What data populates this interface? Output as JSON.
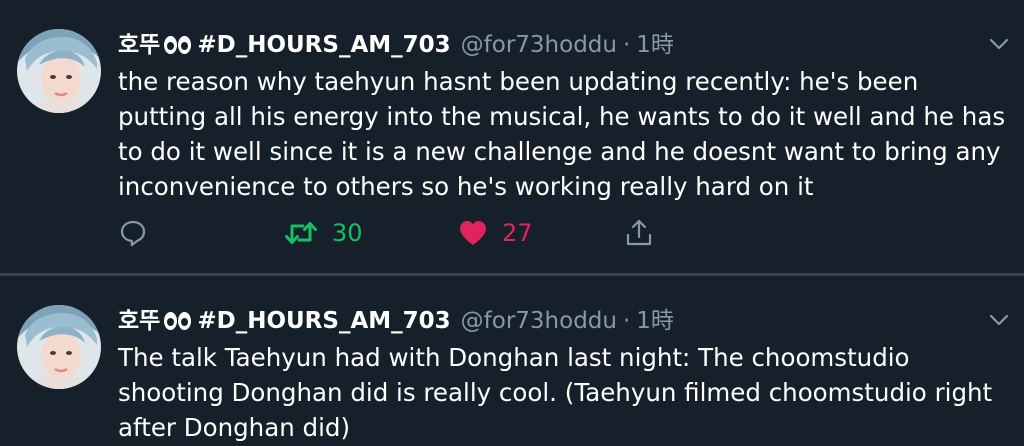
{
  "tweets": [
    {
      "display_name": "호뚜",
      "display_tag": "#D_HOURS_AM_703",
      "handle": "@for73hoddu",
      "separator": "·",
      "time": "1時",
      "text": "the reason why taehyun hasnt been updating recently: he's been putting all his energy into the musical, he wants to do it well and he has to do it well since it is a new challenge and he doesnt want to bring any inconvenience to others so he's working really hard on it",
      "retweet_count": "30",
      "like_count": "27",
      "retweeted": true,
      "liked": true
    },
    {
      "display_name": "호뚜",
      "display_tag": "#D_HOURS_AM_703",
      "handle": "@for73hoddu",
      "separator": "·",
      "time": "1時",
      "text": "The talk Taehyun had with Donghan last night: The choomstudio shooting Donghan did is really cool. (Taehyun filmed choomstudio right after Donghan did)"
    }
  ],
  "icons": {
    "reply": "reply-icon",
    "retweet": "retweet-icon",
    "like": "heart-icon",
    "share": "share-icon",
    "menu": "chevron-down-icon",
    "emoji": "eyes-emoji-icon"
  },
  "colors": {
    "background": "#15202b",
    "divider": "#38444d",
    "secondary_text": "#8899a6",
    "retweet_green": "#17bf63",
    "like_red": "#e0245e"
  }
}
